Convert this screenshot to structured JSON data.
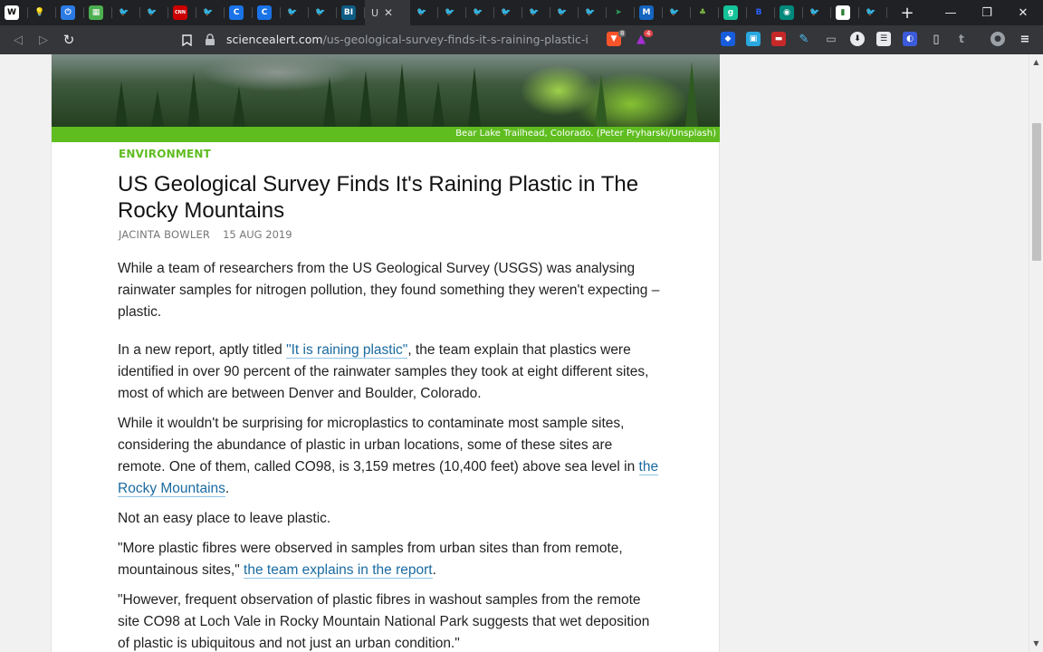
{
  "tabs": [
    {
      "icon": "wikipedia-icon",
      "glyph": "W",
      "bg": "#ffffff",
      "fg": "#000000"
    },
    {
      "icon": "lightbulb-icon",
      "glyph": "💡",
      "bg": "#202124",
      "fg": "#f7d048"
    },
    {
      "icon": "power-icon",
      "glyph": "⏻",
      "bg": "#2c7be5",
      "fg": "#ffffff"
    },
    {
      "icon": "map-icon",
      "glyph": "▦",
      "bg": "#4caf50",
      "fg": "#ffffff"
    },
    {
      "icon": "twitter-icon",
      "glyph": "🐦",
      "bg": "#202124",
      "fg": "#1da1f2"
    },
    {
      "icon": "twitter-icon",
      "glyph": "🐦",
      "bg": "#202124",
      "fg": "#1da1f2"
    },
    {
      "icon": "cnn-icon",
      "glyph": "CNN",
      "bg": "#cc0000",
      "fg": "#ffffff"
    },
    {
      "icon": "twitter-icon",
      "glyph": "🐦",
      "bg": "#202124",
      "fg": "#1da1f2"
    },
    {
      "icon": "c-logo-icon",
      "glyph": "C",
      "bg": "#1a73e8",
      "fg": "#ffffff"
    },
    {
      "icon": "c-logo-icon",
      "glyph": "C",
      "bg": "#1a73e8",
      "fg": "#ffffff"
    },
    {
      "icon": "twitter-icon",
      "glyph": "🐦",
      "bg": "#202124",
      "fg": "#1da1f2"
    },
    {
      "icon": "twitter-icon",
      "glyph": "🐦",
      "bg": "#202124",
      "fg": "#1da1f2"
    },
    {
      "icon": "bi-logo-icon",
      "glyph": "BI",
      "bg": "#0e5c84",
      "fg": "#ffffff"
    }
  ],
  "active_tab": {
    "glyph": "U"
  },
  "tabs_after": [
    {
      "icon": "twitter-icon",
      "glyph": "🐦",
      "bg": "#202124",
      "fg": "#1da1f2"
    },
    {
      "icon": "twitter-icon",
      "glyph": "🐦",
      "bg": "#202124",
      "fg": "#1da1f2"
    },
    {
      "icon": "twitter-icon",
      "glyph": "🐦",
      "bg": "#202124",
      "fg": "#1da1f2"
    },
    {
      "icon": "twitter-icon",
      "glyph": "🐦",
      "bg": "#202124",
      "fg": "#1da1f2"
    },
    {
      "icon": "twitter-icon",
      "glyph": "🐦",
      "bg": "#202124",
      "fg": "#1da1f2"
    },
    {
      "icon": "twitter-icon",
      "glyph": "🐦",
      "bg": "#202124",
      "fg": "#1da1f2"
    },
    {
      "icon": "twitter-icon",
      "glyph": "🐦",
      "bg": "#202124",
      "fg": "#1da1f2"
    },
    {
      "icon": "arrow-logo-icon",
      "glyph": "➤",
      "bg": "#202124",
      "fg": "#2e9d5a"
    },
    {
      "icon": "m-logo-icon",
      "glyph": "M",
      "bg": "#1565c0",
      "fg": "#ffffff"
    },
    {
      "icon": "twitter-icon",
      "glyph": "🐦",
      "bg": "#202124",
      "fg": "#1da1f2"
    },
    {
      "icon": "leaf-icon",
      "glyph": "♣",
      "bg": "#202124",
      "fg": "#7cb342"
    },
    {
      "icon": "g-logo-icon",
      "glyph": "g",
      "bg": "#15c39a",
      "fg": "#ffffff"
    },
    {
      "icon": "b-logo-icon",
      "glyph": "B",
      "bg": "#202124",
      "fg": "#2962ff"
    },
    {
      "icon": "globe-icon",
      "glyph": "◉",
      "bg": "#00897b",
      "fg": "#ffffff"
    },
    {
      "icon": "twitter-icon",
      "glyph": "🐦",
      "bg": "#202124",
      "fg": "#1da1f2"
    },
    {
      "icon": "chart-icon",
      "glyph": "▮",
      "bg": "#ffffff",
      "fg": "#2e7d32"
    },
    {
      "icon": "twitter-icon",
      "glyph": "🐦",
      "bg": "#202124",
      "fg": "#1da1f2"
    }
  ],
  "address_bar": {
    "domain": "sciencealert.com",
    "path": "/us-geological-survey-finds-it-s-raining-plastic-in-th..."
  },
  "extensions": {
    "brave_shield_badge": "8",
    "rewards_badge": "4"
  },
  "article": {
    "photo_caption": "Bear Lake Trailhead, Colorado. (Peter Pryharski/Unsplash)",
    "category": "ENVIRONMENT",
    "title": "US Geological Survey Finds It's Raining Plastic in The Rocky Mountains",
    "author": "JACINTA BOWLER",
    "date": "15 AUG 2019",
    "p1": "While a team of researchers from the US Geological Survey (USGS) was analysing rainwater samples for nitrogen pollution, they found something they weren't expecting – plastic.",
    "p2_before": "In a new report, aptly titled ",
    "p2_link": "\"It is raining plastic\"",
    "p2_after": ", the team explain that plastics were identified in over 90 percent of the rainwater samples they took at eight different sites, most of which are between Denver and Boulder, Colorado.",
    "p3_before": "While it wouldn't be surprising for microplastics to contaminate most sample sites, considering the abundance of plastic in urban locations, some of these sites are remote. One of them, called CO98, is 3,159 metres (10,400 feet) above sea level in ",
    "p3_link": "the Rocky Mountains",
    "p3_after": ".",
    "p4": "Not an easy place to leave plastic.",
    "p5_before": "\"More plastic fibres were observed in samples from urban sites than from remote, mountainous sites,\" ",
    "p5_link": "the team explains in the report",
    "p5_after": ".",
    "p6": "\"However, frequent observation of plastic fibres in washout samples from the remote site CO98 at Loch Vale in Rocky Mountain National Park suggests that wet deposition of plastic is ubiquitous and not just an urban condition.\""
  }
}
